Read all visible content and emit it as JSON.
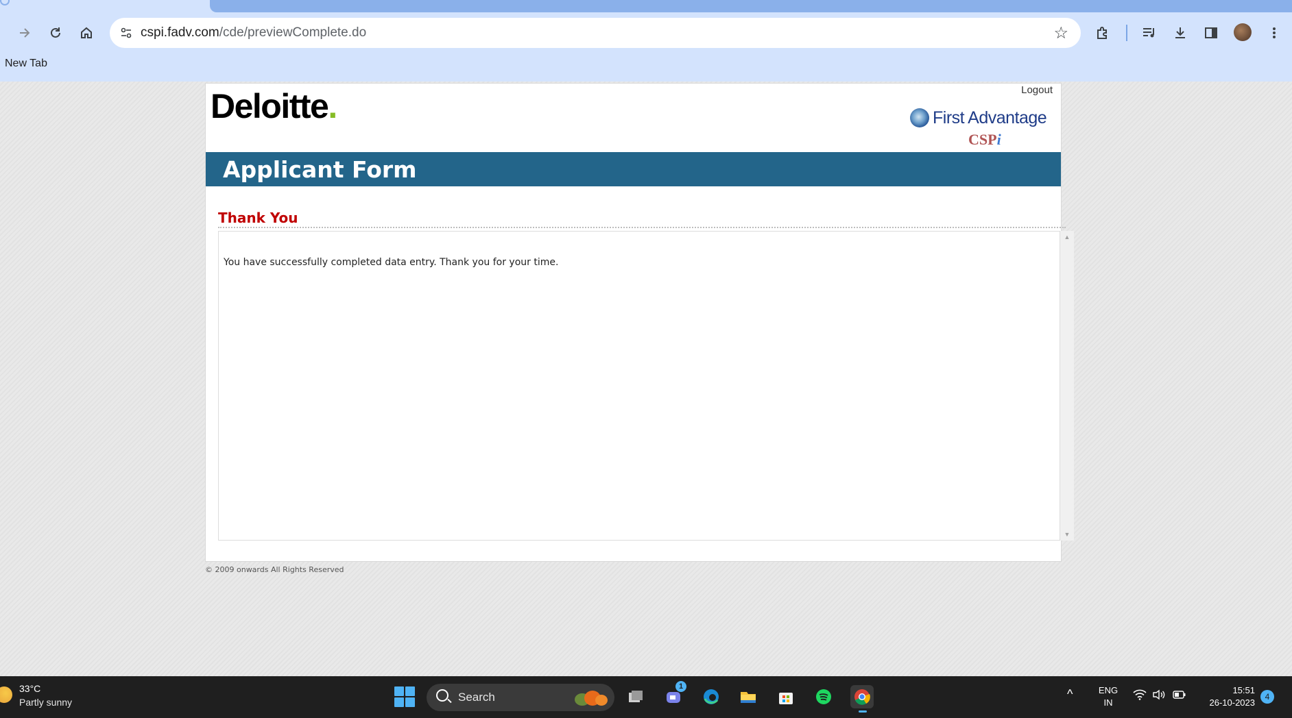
{
  "browser": {
    "tab_title": "New Tab",
    "url_domain": "cspi.fadv.com",
    "url_path": "/cde/previewComplete.do",
    "bookmark_label": "New Tab"
  },
  "page": {
    "logo_text": "Deloitte",
    "logo_dot": ".",
    "logout_label": "Logout",
    "partner_name": "First Advantage",
    "partner_sub": "CSP",
    "partner_sub_i": "i",
    "banner_title": "Applicant Form",
    "section_title": "Thank You",
    "message": "You have successfully completed data entry. Thank you for your time.",
    "footer": "© 2009 onwards All Rights Reserved"
  },
  "taskbar": {
    "weather_temp": "33°C",
    "weather_desc": "Partly sunny",
    "search_label": "Search",
    "teams_badge": "1",
    "lang_line1": "ENG",
    "lang_line2": "IN",
    "time": "15:51",
    "date": "26-10-2023",
    "notification_count": "4"
  },
  "colors": {
    "banner": "#23658a",
    "section_title": "#c00000",
    "deloitte_dot": "#86bc25",
    "chrome_bg": "#d3e3fd"
  }
}
